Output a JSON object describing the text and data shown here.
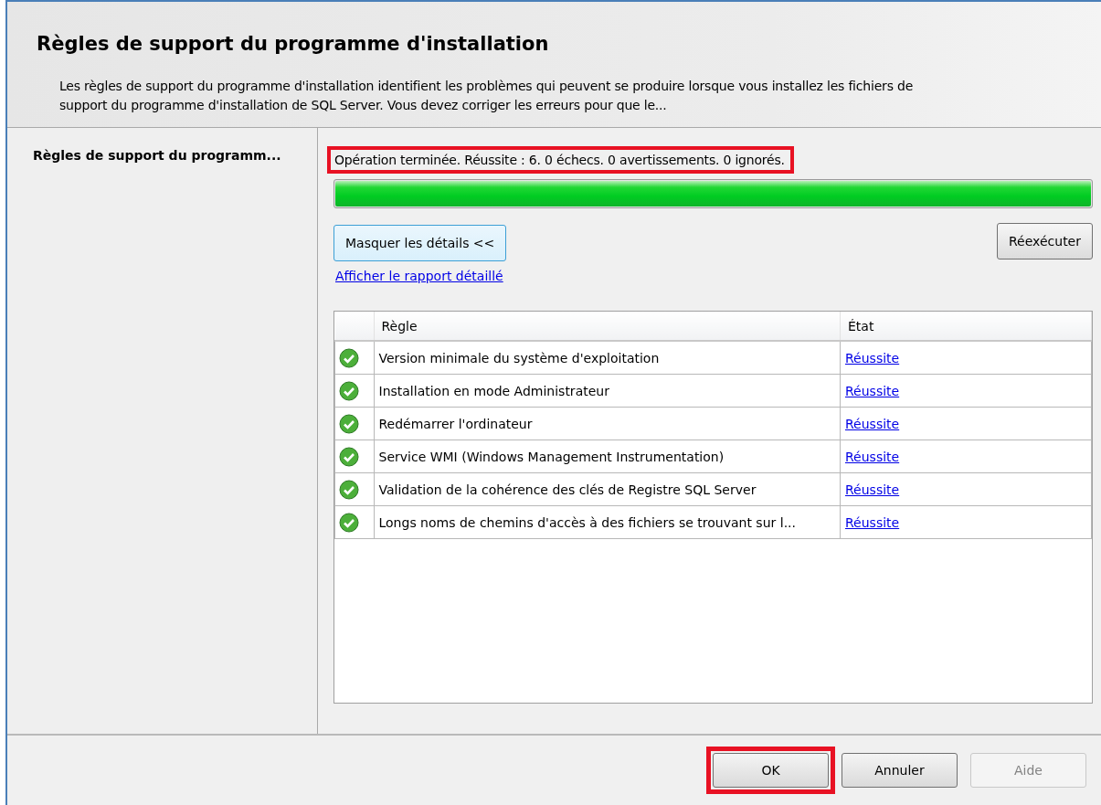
{
  "header": {
    "title": "Règles de support du programme d'installation",
    "description": "Les règles de support du programme d'installation identifient les problèmes qui peuvent se produire lorsque vous installez les fichiers de support du programme d'installation de SQL Server. Vous devez corriger les erreurs pour que le..."
  },
  "sidebar": {
    "items": [
      {
        "label": "Règles de support du programm...",
        "selected": true
      }
    ]
  },
  "status": {
    "text": "Opération terminée. Réussite : 6. 0 échecs. 0 avertissements. 0 ignorés.",
    "highlighted": true
  },
  "progress": {
    "level": 1
  },
  "buttons": {
    "details": "Masquer les détails <<",
    "rerun": "Réexécuter"
  },
  "report_link": "Afficher le rapport détaillé",
  "table": {
    "columns": [
      "Règle",
      "État"
    ],
    "rows": [
      {
        "rule": "Version minimale du système d'exploitation",
        "state": "Réussite",
        "kind": "passed"
      },
      {
        "rule": "Installation en mode Administrateur",
        "state": "Réussite",
        "kind": "passed"
      },
      {
        "rule": "Redémarrer l'ordinateur",
        "state": "Réussite",
        "kind": "passed"
      },
      {
        "rule": "Service WMI (Windows Management Instrumentation)",
        "state": "Réussite",
        "kind": "passed"
      },
      {
        "rule": "Validation de la cohérence des clés de Registre SQL Server",
        "state": "Réussite",
        "kind": "passed"
      },
      {
        "rule": "Longs noms de chemins d'accès à des fichiers se trouvant sur l...",
        "state": "Réussite",
        "kind": "passed"
      }
    ]
  },
  "footer_buttons": [
    {
      "label": "OK",
      "disabled": false,
      "highlighted": true
    },
    {
      "label": "Annuler",
      "disabled": false,
      "highlighted": false
    },
    {
      "label": "Aide",
      "disabled": true,
      "highlighted": false
    }
  ]
}
